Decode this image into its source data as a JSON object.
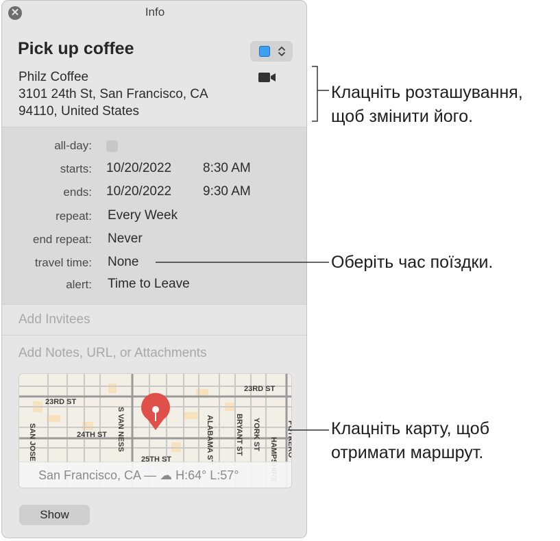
{
  "window": {
    "title": "Info",
    "close_icon": "close-icon"
  },
  "event": {
    "title": "Pick up coffee",
    "calendar_color": "#3e9ef0",
    "location_name": "Philz Coffee",
    "address_line1": "3101 24th St, San Francisco, CA",
    "address_line2": "94110, United States"
  },
  "details": {
    "allday_label": "all-day:",
    "starts_label": "starts:",
    "starts_date": "10/20/2022",
    "starts_time": "8:30 AM",
    "ends_label": "ends:",
    "ends_date": "10/20/2022",
    "ends_time": "9:30 AM",
    "repeat_label": "repeat:",
    "repeat_value": "Every Week",
    "end_repeat_label": "end repeat:",
    "end_repeat_value": "Never",
    "travel_label": "travel time:",
    "travel_value": "None",
    "alert_label": "alert:",
    "alert_value": "Time to Leave"
  },
  "invitees_placeholder": "Add Invitees",
  "notes_placeholder": "Add Notes, URL, or Attachments",
  "map": {
    "streets": {
      "s23_right": "23RD ST",
      "s23_left": "23RD ST",
      "s24": "24TH ST",
      "s25": "25TH ST",
      "svanness": "S VAN NESS",
      "alabama": "ALABAMA ST",
      "bryant": "BRYANT ST",
      "york": "YORK ST",
      "hampshire": "HAMPSHIRE",
      "potrero": "POTRERO",
      "sanjose": "SAN JOSE"
    },
    "weather": "San Francisco, CA — ☁ H:64° L:57°"
  },
  "show_button": "Show",
  "callouts": {
    "location_line1": "Клацніть розташування,",
    "location_line2": "щоб змінити його.",
    "travel": "Оберіть час поїздки.",
    "map_line1": "Клацніть карту, щоб",
    "map_line2": "отримати маршрут."
  }
}
